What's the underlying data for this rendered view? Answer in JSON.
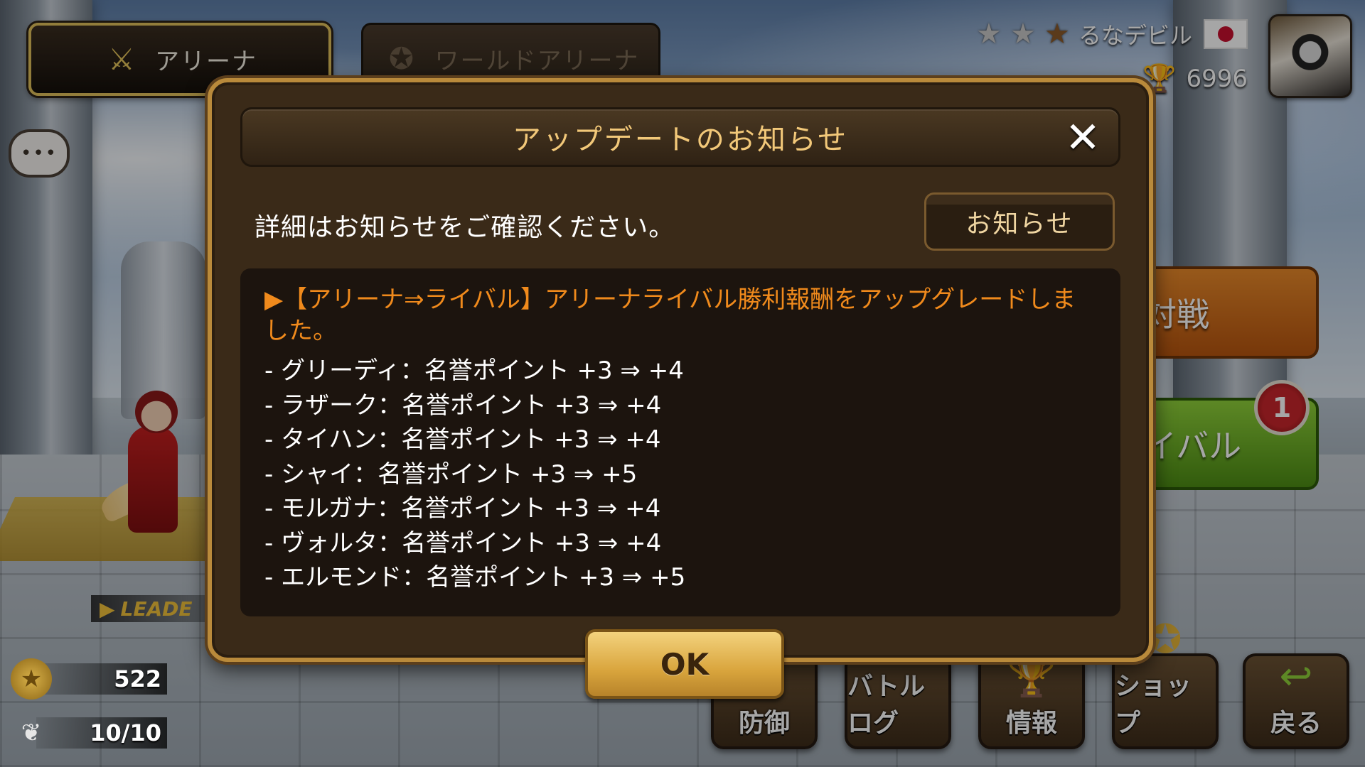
{
  "top": {
    "tab_arena": "アリーナ",
    "tab_world_arena": "ワールドアリーナ"
  },
  "player": {
    "name": "るなデビル",
    "stars_filled": 2,
    "stars_total": 3,
    "country_flag": "Japan",
    "trophy_count": "6996"
  },
  "side_buttons": {
    "battle_label": "対戦",
    "rival_label": "イバル",
    "rival_badge": "1"
  },
  "left": {
    "leader_label": "LEADE",
    "medal_value": "522",
    "wings_value": "10/10"
  },
  "bottom_menu": [
    {
      "label": "防御",
      "icon": "shield-icon"
    },
    {
      "label": "バトルログ",
      "icon": "crossed-swords-icon"
    },
    {
      "label": "情報",
      "icon": "trophy-icon"
    },
    {
      "label": "ショップ",
      "icon": "star-coin-icon"
    },
    {
      "label": "戻る",
      "icon": "return-arrow-icon"
    }
  ],
  "modal": {
    "title": "アップデートのお知らせ",
    "subtitle": "詳細はお知らせをご確認ください。",
    "notice_button": "お知らせ",
    "headline": "▶【アリーナ⇒ライバル】アリーナライバル勝利報酬をアップグレードしました。",
    "items": [
      "- グリーディ：名誉ポイント +3 ⇒ +4",
      "- ラザーク：名誉ポイント +3 ⇒ +4",
      "- タイハン：名誉ポイント +3 ⇒ +4",
      "- シャイ：名誉ポイント +3 ⇒ +5",
      "- モルガナ：名誉ポイント +3 ⇒ +4",
      "- ヴォルタ：名誉ポイント +3 ⇒ +4",
      "- エルモンド：名誉ポイント +3 ⇒ +5"
    ],
    "ok_label": "OK"
  },
  "colors": {
    "modal_border": "#b98a3b",
    "title_text": "#f2c879",
    "headline_text": "#f08a1c",
    "ok_button": "#d9a53d",
    "battle_button": "#e8892a",
    "rival_button": "#8fd13a"
  }
}
